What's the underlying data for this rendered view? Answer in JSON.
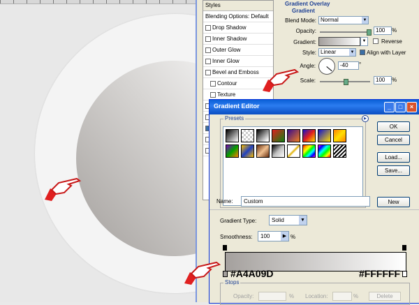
{
  "layer_style": {
    "styles_header": "Styles",
    "items": [
      {
        "label": "Blending Options: Default",
        "checkbox": false,
        "sub": false
      },
      {
        "label": "Drop Shadow",
        "checkbox": true,
        "sub": false
      },
      {
        "label": "Inner Shadow",
        "checkbox": true,
        "sub": false
      },
      {
        "label": "Outer Glow",
        "checkbox": true,
        "sub": false
      },
      {
        "label": "Inner Glow",
        "checkbox": true,
        "sub": false
      },
      {
        "label": "Bevel and Emboss",
        "checkbox": true,
        "sub": false
      },
      {
        "label": "Contour",
        "checkbox": true,
        "sub": true
      },
      {
        "label": "Texture",
        "checkbox": true,
        "sub": true
      }
    ],
    "gradient_overlay": {
      "section_title": "Gradient Overlay",
      "group_title": "Gradient",
      "blend_mode_label": "Blend Mode:",
      "blend_mode_value": "Normal",
      "opacity_label": "Opacity:",
      "opacity_value": "100",
      "opacity_unit": "%",
      "gradient_label": "Gradient:",
      "reverse_label": "Reverse",
      "style_label": "Style:",
      "style_value": "Linear",
      "align_label": "Align with Layer",
      "angle_label": "Angle:",
      "angle_value": "-40",
      "angle_unit": "°",
      "scale_label": "Scale:",
      "scale_value": "100",
      "scale_unit": "%"
    }
  },
  "gradient_editor": {
    "title": "Gradient Editor",
    "presets_label": "Presets",
    "ok_label": "OK",
    "cancel_label": "Cancel",
    "load_label": "Load...",
    "save_label": "Save...",
    "name_label": "Name:",
    "name_value": "Custom",
    "new_label": "New",
    "gradient_type_label": "Gradient Type:",
    "gradient_type_value": "Solid",
    "smoothness_label": "Smoothness:",
    "smoothness_value": "100",
    "smoothness_unit": "%",
    "stop_left_hex": "#A4A09D",
    "stop_right_hex": "#FFFFFF",
    "stops_label": "Stops",
    "stops_opacity_label": "Opacity:",
    "stops_location_label": "Location:",
    "stops_pct": "%",
    "delete_label": "Delete"
  },
  "colors": {
    "gradient_start": "#A4A09D",
    "gradient_end": "#FFFFFF",
    "title_blue": "#0a5fd6",
    "hand_red": "#e02020"
  }
}
